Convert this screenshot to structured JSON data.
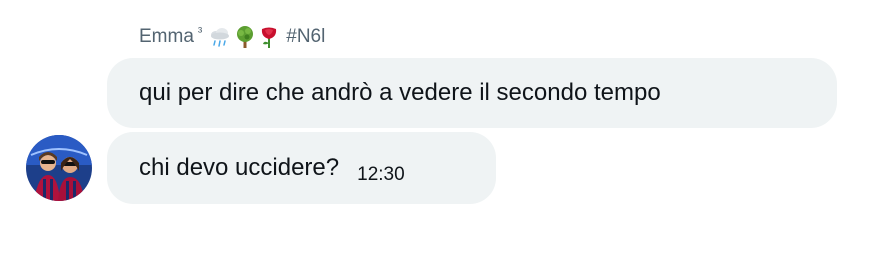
{
  "conversation": {
    "sender": {
      "name": "Emma",
      "superscript": "³",
      "emojis": [
        "cloud-with-rain-icon",
        "tree-icon",
        "rose-icon"
      ],
      "tag": "#N6l"
    },
    "messages": [
      {
        "text": "qui per dire che andrò a vedere il secondo tempo",
        "time": ""
      },
      {
        "text": "chi devo uccidere?",
        "time": "12:30"
      }
    ]
  },
  "colors": {
    "bubble_background": "#eff3f4",
    "sender_text": "#536471",
    "message_text": "#0f1419"
  }
}
